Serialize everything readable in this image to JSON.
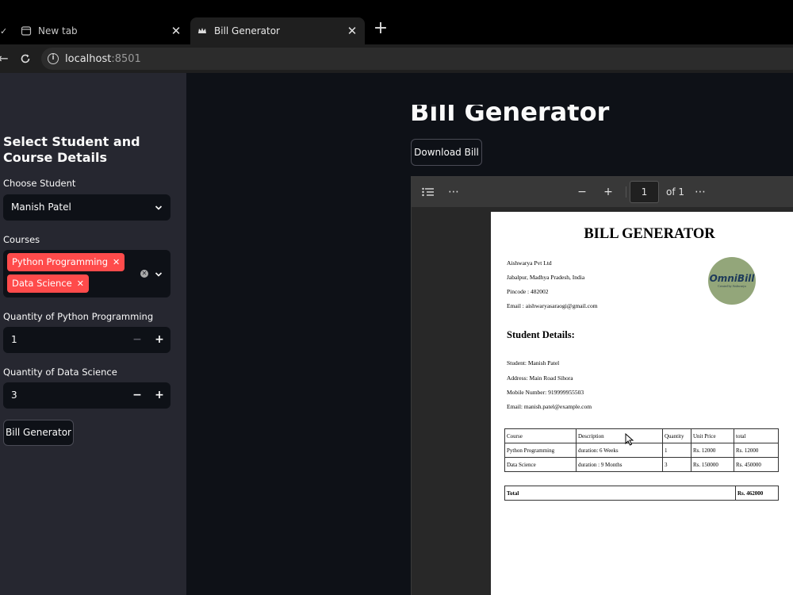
{
  "browser": {
    "tabs": [
      {
        "title": "New tab",
        "active": false
      },
      {
        "title": "Bill Generator",
        "active": true
      }
    ],
    "url_host": "localhost",
    "url_port": ":8501"
  },
  "sidebar": {
    "title": "Select Student and Course Details",
    "student_label": "Choose Student",
    "student_value": "Manish Patel",
    "courses_label": "Courses",
    "courses_selected": [
      "Python Programming",
      "Data Science"
    ],
    "qty_python_label": "Quantity of Python Programming",
    "qty_python_value": "1",
    "qty_ds_label": "Quantity of Data Science",
    "qty_ds_value": "3",
    "bill_button_label": "Bill Generator"
  },
  "main": {
    "title": "Bill Generator",
    "download_label": "Download Bill"
  },
  "pdf_viewer": {
    "page_number": "1",
    "page_total_label": "of 1"
  },
  "bill": {
    "heading": "BILL GENERATOR",
    "company_name": "Aishwarya Pvt Ltd",
    "company_address": "Jabalpur, Madhya Pradesh, India",
    "pincode": "Pincode : 482002",
    "email": "Email : aishwaryasaraogi@gmail.com",
    "logo_text": "OmniBill",
    "logo_subtext": "Created by Aishwarya",
    "student_heading": "Student Details:",
    "student_name": "Student:  Manish Patel",
    "student_address": "Address:  Main Road Sihora",
    "student_mobile": "Mobile Number: 919999955503",
    "student_email": "Email:  manish.patel@example.com",
    "table_headers": [
      "Course",
      "Description",
      "Quantity",
      "Unit Price",
      "total"
    ],
    "rows": [
      [
        "Python Programming",
        "duration: 6 Weeks",
        "1",
        "Rs. 12000",
        "Rs. 12000"
      ],
      [
        "Data Science",
        "duration : 9 Months",
        "3",
        "Rs. 150000",
        "Rs. 450000"
      ]
    ],
    "total_label": "Total",
    "total_value": "Rs. 462000"
  },
  "colors": {
    "accent": "#ff4b4b",
    "sidebar_bg": "#262730",
    "main_bg": "#0e1117"
  }
}
